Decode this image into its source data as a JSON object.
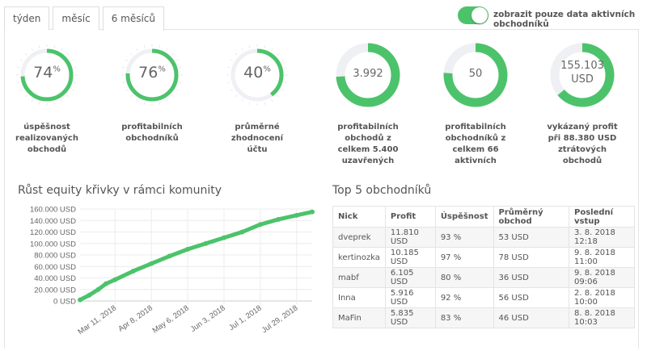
{
  "tabs": [
    {
      "label": "týden"
    },
    {
      "label": "měsíc"
    },
    {
      "label": "6 měsíců",
      "active": true
    }
  ],
  "toggle": {
    "label": "zobrazit pouze data aktivních obchodníků",
    "on": true
  },
  "accent": "#4cc36b",
  "stats": [
    {
      "value": "74",
      "unit": "%",
      "fill": 0.74,
      "label": "úspěšnost\nrealizovaných\nobchodů"
    },
    {
      "value": "76",
      "unit": "%",
      "fill": 0.76,
      "label": "profitabilních\nobchodníků"
    },
    {
      "value": "40",
      "unit": "%",
      "fill": 0.4,
      "label": "průměrné\nzhodnocení\núčtu"
    },
    {
      "value": "3.992",
      "unit": "",
      "fill": 0.74,
      "label": "profitabilních\nobchodů z\ncelkem 5.400\nuzavřených"
    },
    {
      "value": "50",
      "unit": "",
      "fill": 0.76,
      "label": "profitabilních\nobchodníků z\ncelkem 66\naktivních"
    },
    {
      "value": "155.103",
      "unit": "USD",
      "fill": 0.64,
      "label": "vykázaný profit\npři 88.380 USD\nztrátových\nobchodů"
    }
  ],
  "chart_title": "Růst equity křivky v rámci komunity",
  "chart_data": {
    "type": "line",
    "x": [
      "2018-02-12",
      "2018-02-19",
      "2018-02-26",
      "2018-03-04",
      "2018-03-11",
      "2018-03-25",
      "2018-04-08",
      "2018-04-22",
      "2018-05-06",
      "2018-05-20",
      "2018-06-03",
      "2018-06-17",
      "2018-07-01",
      "2018-07-15",
      "2018-07-29",
      "2018-08-10"
    ],
    "values": [
      2000,
      10000,
      20000,
      30000,
      37000,
      52000,
      65000,
      78000,
      90000,
      100000,
      110000,
      120000,
      133000,
      142000,
      149000,
      155000
    ],
    "ylim": [
      0,
      160000
    ],
    "yticks": [
      "0 USD",
      "20.000 USD",
      "40.000 USD",
      "60.000 USD",
      "80.000 USD",
      "100.000 USD",
      "120.000 USD",
      "140.000 USD",
      "160.000 USD"
    ],
    "xticks": [
      "Mar 11, 2018",
      "Apr 8, 2018",
      "May 6, 2018",
      "Jun 3, 2018",
      "Jul 1, 2018",
      "Jul 29, 2018"
    ],
    "xtick_dates": [
      "2018-03-11",
      "2018-04-08",
      "2018-05-06",
      "2018-06-03",
      "2018-07-01",
      "2018-07-29"
    ],
    "grid": true,
    "color": "#4cc36b"
  },
  "top_title": "Top 5 obchodníků",
  "table": {
    "headers": [
      "Nick",
      "Profit",
      "Úspěšnost",
      "Průměrný obchod",
      "Poslední vstup"
    ],
    "rows": [
      [
        "dveprek",
        "11.810 USD",
        "93 %",
        "53 USD",
        "3. 8. 2018 12:18"
      ],
      [
        "kertinozka",
        "10.185 USD",
        "97 %",
        "78 USD",
        "9. 8. 2018 11:00"
      ],
      [
        "mabf",
        "6.105 USD",
        "80 %",
        "36 USD",
        "9. 8. 2018 09:06"
      ],
      [
        "Inna",
        "5.916 USD",
        "92 %",
        "56 USD",
        "2. 8. 2018 10:00"
      ],
      [
        "MaFin",
        "5.835 USD",
        "83 %",
        "46 USD",
        "8. 8. 2018 10:03"
      ]
    ]
  }
}
